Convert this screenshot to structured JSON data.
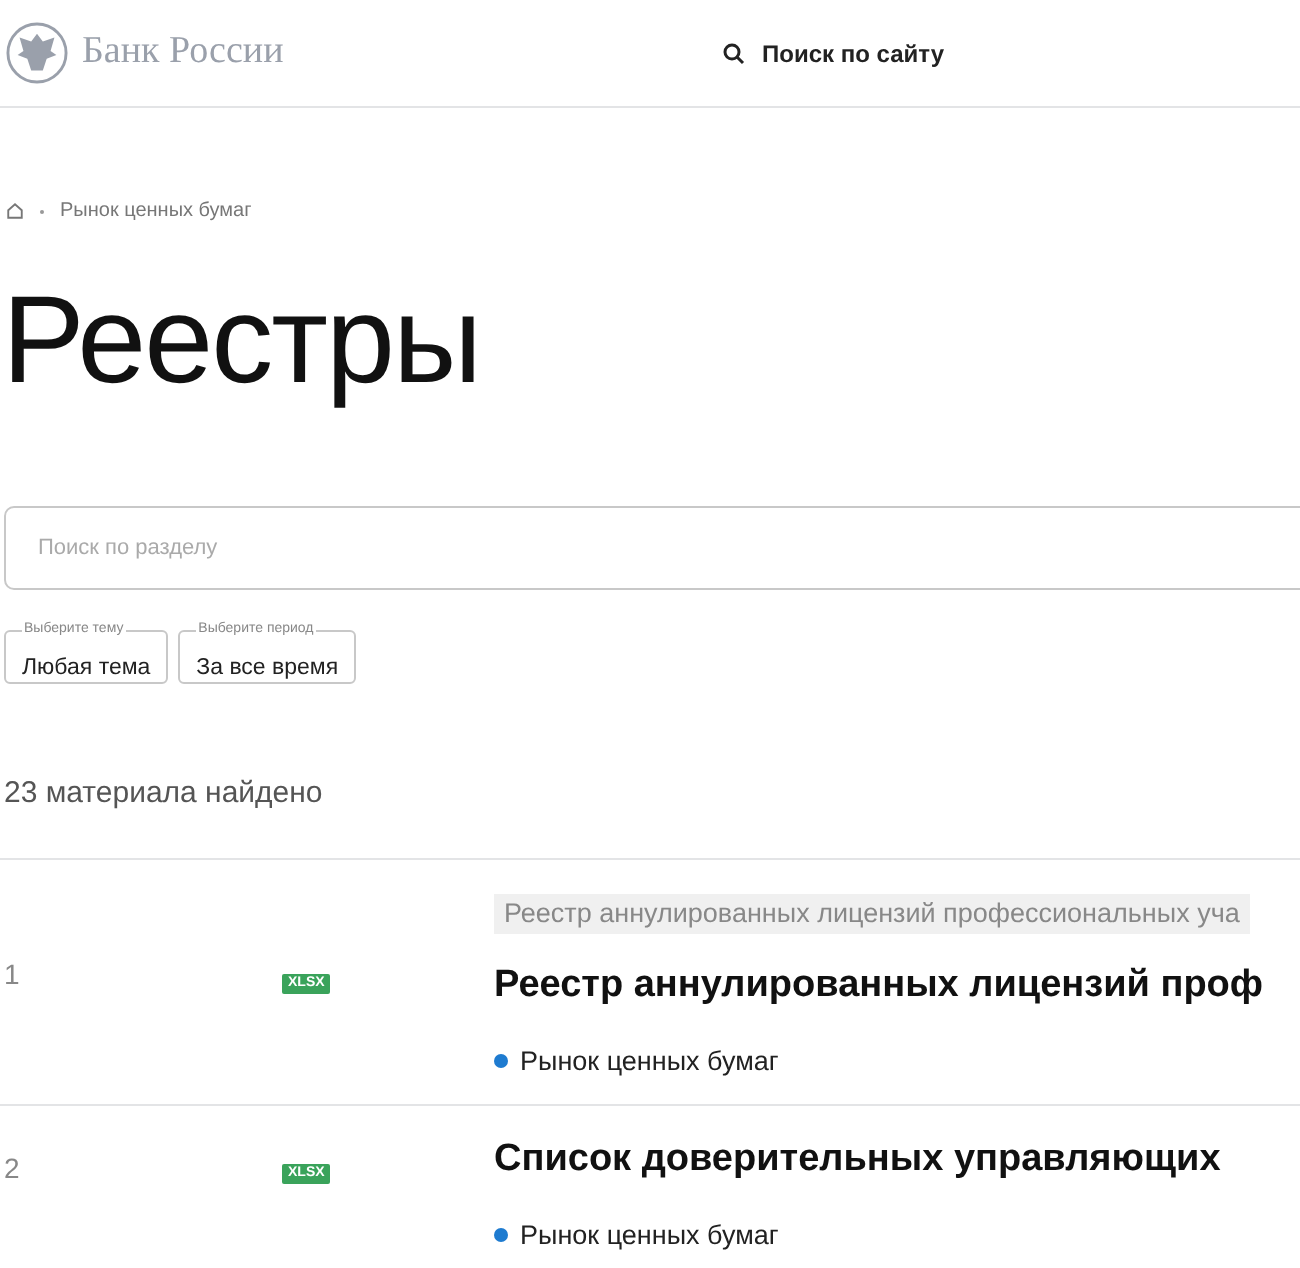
{
  "header": {
    "brand": "Банк России",
    "search_link": "Поиск по сайту"
  },
  "breadcrumbs": [
    "Рынок ценных бумаг"
  ],
  "title": "Реестры",
  "search": {
    "placeholder": "Поиск по разделу"
  },
  "filters": [
    {
      "legend": "Выберите тему",
      "value": "Любая тема"
    },
    {
      "legend": "Выберите период",
      "value": "За все время"
    }
  ],
  "results_count": "23 материала найдено",
  "results": [
    {
      "number": "1",
      "format": "XLSX",
      "section_label": "Реестр аннулированных лицензий профессиональных уча",
      "title": "Реестр аннулированных лицензий проф",
      "topic": "Рынок ценных бумаг"
    },
    {
      "number": "2",
      "format": "XLSX",
      "title": "Список доверительных управляющих",
      "topic": "Рынок ценных бумаг"
    }
  ]
}
